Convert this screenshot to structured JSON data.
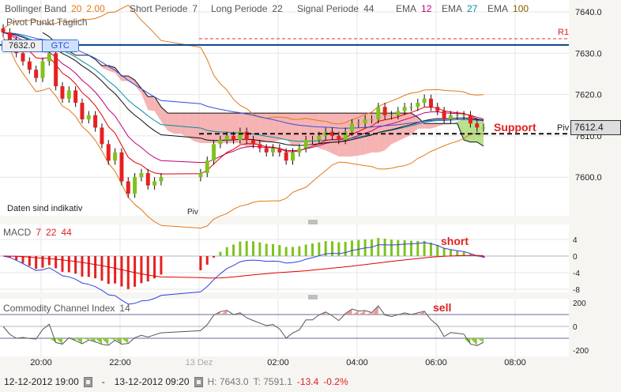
{
  "legend": {
    "bollinger": {
      "label": "Bollinger Band",
      "p1": "20",
      "p2": "2.00"
    },
    "short": {
      "label": "Short Periode",
      "val": "7"
    },
    "long": {
      "label": "Long Periode",
      "val": "22"
    },
    "signal": {
      "label": "Signal Periode",
      "val": "44"
    },
    "ema1": {
      "label": "EMA",
      "val": "12"
    },
    "ema2": {
      "label": "EMA",
      "val": "27"
    },
    "ema3": {
      "label": "EMA",
      "val": "100"
    },
    "pivot": "Pivot Punkt  Täglich",
    "indicative": "Daten sind indikativ"
  },
  "order": {
    "price": "7632.0",
    "type": "GTC"
  },
  "annotations": {
    "r1": "R1",
    "support": "Support",
    "piv": "Piv",
    "piv_bottom": "Piv",
    "short": "short",
    "sell": "sell"
  },
  "colors": {
    "up": "#7fc31c",
    "down": "#e82020",
    "ema12": "#c0007a",
    "ema27": "#0090a0",
    "ema100": "#8a5a00",
    "boll": "#e07818",
    "macd": "#3040e0",
    "signal": "#e00000"
  },
  "footer": {
    "from": "12-12-2012 19:00",
    "sep": "-",
    "to": "13-12-2012 09:20",
    "high": "H: 7643.0",
    "low": "T: 7591.1",
    "change": "-13.4",
    "pct": "-0.2%"
  },
  "chart_data": {
    "type": "candlestick",
    "interval_minutes": 10,
    "start": "19:00",
    "closes": [
      7635,
      7633,
      7630,
      7628,
      7626,
      7624,
      7628,
      7630,
      7622,
      7619,
      7621,
      7618,
      7614,
      7615,
      7612,
      7608,
      7604,
      7606,
      7599,
      7596,
      7600,
      7601,
      7598,
      7599,
      7600,
      null,
      null,
      null,
      null,
      null,
      7601,
      7604,
      7608,
      7609,
      7610,
      7609,
      7611,
      7609,
      7608,
      7607,
      7606,
      7607,
      7606,
      7604,
      7606,
      7607,
      7609,
      7609,
      7610,
      7611,
      7610,
      7609,
      7611,
      7613,
      7613,
      7614,
      7614,
      7617,
      7615,
      7615,
      7616,
      7617,
      7617,
      7618,
      7619,
      7617,
      7616,
      7614,
      7615,
      7615,
      7615,
      7613,
      7612,
      7612
    ],
    "price_axis": {
      "ticks": [
        "7640.0",
        "7630.0",
        "7620.0",
        "7610.0",
        "7600.0"
      ],
      "ylim": [
        7597,
        7643
      ]
    },
    "x_ticks": [
      "20:00",
      "22:00",
      "13 Dez",
      "02:00",
      "04:00",
      "06:00",
      "08:00"
    ],
    "levels": {
      "order": 7632.0,
      "r1": 7633.5,
      "pivot": 7612.4,
      "support": 7610.5
    },
    "last_price": "7612.4",
    "macd": {
      "title": "MACD",
      "params": [
        "7",
        "22",
        "44"
      ],
      "ticks": [
        "4",
        "0",
        "-4",
        "-8"
      ]
    },
    "cci": {
      "title": "Commodity Channel Index",
      "param": "14",
      "ticks": [
        "200",
        "0",
        "-200"
      ]
    }
  }
}
